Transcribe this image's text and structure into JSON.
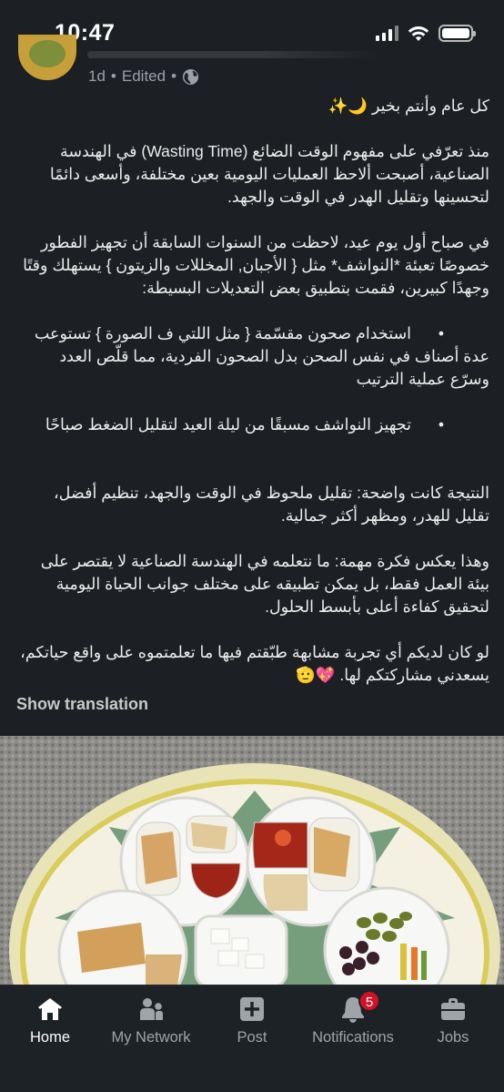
{
  "status_bar": {
    "time": "10:47"
  },
  "post": {
    "meta_age": "1d",
    "meta_separator": "•",
    "meta_edited": "Edited",
    "meta_separator2": "•",
    "paragraphs": [
      "كل عام وأنتم بخير 🌙✨",
      "منذ تعرّفي على مفهوم الوقت الضائع (Wasting Time) في الهندسة الصناعية، أصبحت ألاحظ العمليات اليومية بعين مختلفة، وأسعى دائمًا لتحسينها وتقليل الهدر في الوقت والجهد.",
      "في صباح أول يوم عيد، لاحظت من السنوات السابقة أن تجهيز الفطور خصوصًا تعبئة *النواشف* مثل { الأجبان, المخللات والزيتون } يستهلك وقتًا وجهدًا كبيرين، فقمت بتطبيق بعض التعديلات البسيطة:"
    ],
    "bullets": [
      {
        "first_line": "استخدام صحون مقسّمة { مثل اللتي ف الصورة } تستوعب",
        "rest": "عدة أصناف في نفس الصحن بدل الصحون الفردية، مما قلّص العدد وسرّع عملية الترتيب"
      },
      {
        "first_line": "تجهيز النواشف مسبقًا من ليلة العيد لتقليل الضغط صباحًا",
        "rest": ""
      }
    ],
    "bullet_symbol": "•",
    "paragraphs_after": [
      "النتيجة كانت واضحة: تقليل ملحوظ في الوقت والجهد، تنظيم أفضل، تقليل للهدر، ومظهر أكثر جمالية.",
      "وهذا يعكس فكرة مهمة: ما نتعلمه في الهندسة الصناعية لا يقتصر على بيئة العمل فقط، بل يمكن تطبيقه على مختلف جوانب الحياة اليومية لتحقيق كفاءة أعلى بأبسط الحلول.",
      "لو كان لديكم أي تجربة مشابهة طبّقتم فيها ما تعلمتموه على واقع حياتكم، يسعدني مشاركتكم لها. 💖🫡"
    ],
    "show_translation": "Show translation"
  },
  "bottom_nav": {
    "items": [
      {
        "label": "Home",
        "icon": "home-icon",
        "active": true
      },
      {
        "label": "My Network",
        "icon": "network-icon",
        "active": false
      },
      {
        "label": "Post",
        "icon": "post-icon",
        "active": false
      },
      {
        "label": "Notifications",
        "icon": "bell-icon",
        "active": false,
        "badge": "5"
      },
      {
        "label": "Jobs",
        "icon": "briefcase-icon",
        "active": false
      }
    ]
  },
  "colors": {
    "background": "#1c1f23",
    "text": "#ececec",
    "muted": "#9aa0a6",
    "badge": "#d11124"
  }
}
